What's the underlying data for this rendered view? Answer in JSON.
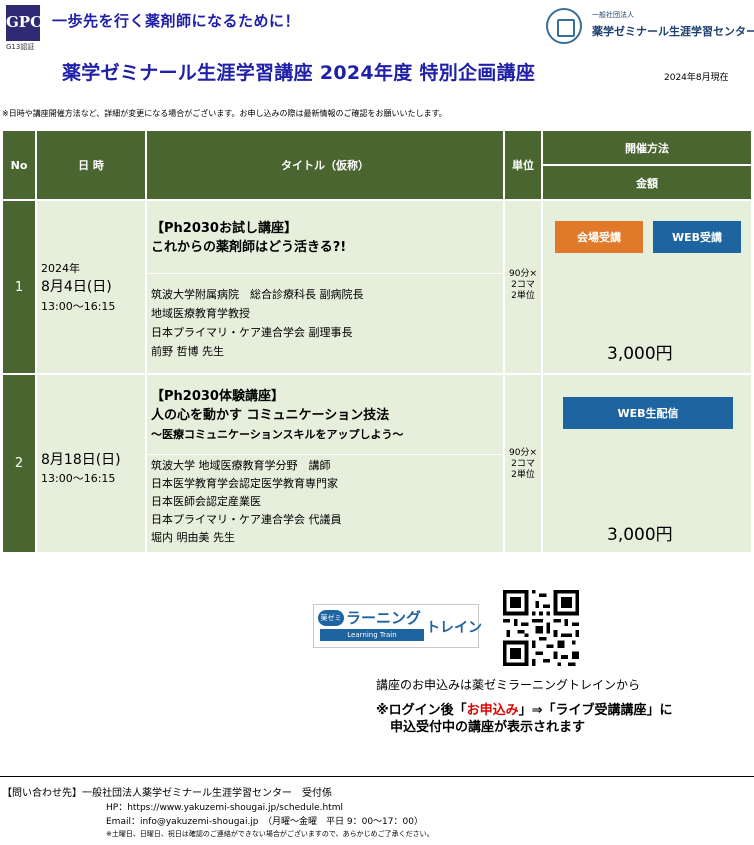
{
  "header": {
    "gpc_logo_text": "GPC",
    "gpc_label": "G13認証",
    "tagline": "一歩先を行く薬剤師になるために！",
    "center_small": "一般社団法人",
    "center_name": "薬学ゼミナール生涯学習センター",
    "title": "薬学ゼミナール生涯学習講座 2024年度 特別企画講座",
    "as_of": "2024年8月現在",
    "notice": "※日時や講座開催方法など、詳細が変更になる場合がございます。お申し込みの際は最新情報のご確認をお願いいたします。"
  },
  "table": {
    "headers": {
      "no": "No",
      "date": "日 時",
      "title": "タイトル（仮称）",
      "unit": "単位",
      "method": "開催方法",
      "fee": "金額"
    },
    "rows": [
      {
        "no": "1",
        "year": "2024年",
        "date": "8月4日(日)",
        "time": "13:00～16:15",
        "title1": "【Ph2030お試し講座】",
        "title2": "これからの薬剤師はどう活きる?!",
        "subtitle": "",
        "affiliations": [
          "筑波大学附属病院　総合診療科長 副病院長",
          "地域医療教育学教授",
          "日本プライマリ・ケア連合学会 副理事長",
          "前野 哲博 先生"
        ],
        "unit": [
          "90分×",
          "2コマ",
          "2単位"
        ],
        "buttons": [
          "会場受講",
          "WEB受講"
        ],
        "price": "3,000円"
      },
      {
        "no": "2",
        "year": "",
        "date": "8月18日(日)",
        "time": "13:00～16:15",
        "title1": "【Ph2030体験講座】",
        "title2": "人の心を動かす コミュニケーション技法",
        "subtitle": "～医療コミュニケーションスキルをアップしよう～",
        "affiliations": [
          "筑波大学 地域医療教育学分野　講師",
          "日本医学教育学会認定医学教育専門家",
          "日本医師会認定産業医",
          "日本プライマリ・ケア連合学会 代議員",
          "堀内 明由美 先生"
        ],
        "unit": [
          "90分×",
          "2コマ",
          "2単位"
        ],
        "buttons": [
          "WEB生配信"
        ],
        "price": "3,000円"
      }
    ]
  },
  "colors": {
    "header_green": "#4a6530",
    "row_bg": "#e6efdc",
    "orange_button": "#e07a2a",
    "blue_button": "#1e64a0",
    "title_blue": "#1f1fa8",
    "red": "#e00000"
  },
  "apply": {
    "logo_top": "薬ゼミ",
    "logo_main": "ラーニング",
    "logo_sub": "Learning Train",
    "logo_right": "トレイン",
    "text": "講座のお申込みは薬ゼミラーニングトレインから",
    "note_a": "※ログイン後「",
    "note_red": "お申込み",
    "note_b": "」⇒「ライブ受講講座」に",
    "note_line2": "申込受付中の講座が表示されます"
  },
  "contact": {
    "title": "【問い合わせ先】一般社団法人薬学ゼミナール生涯学習センター　受付係",
    "hp": "HP：https://www.yakuzemi-shougai.jp/schedule.html",
    "email": "Email：info@yakuzemi-shougai.jp　（月曜～金曜　平日 9：00～17：00）",
    "note": "※土曜日、日曜日、祝日は確認のご連絡ができない場合がございますので、あらかじめご了承ください。"
  }
}
